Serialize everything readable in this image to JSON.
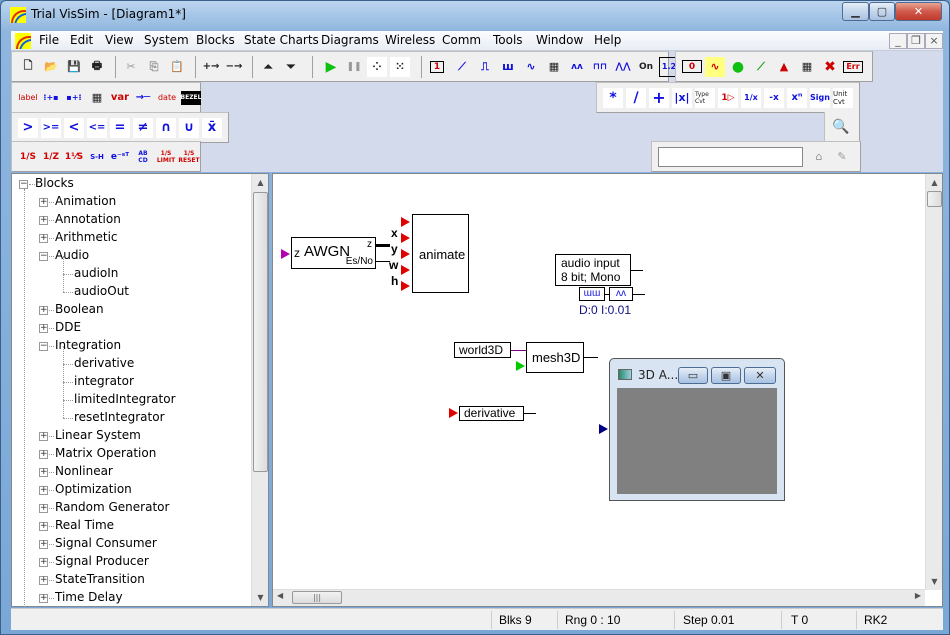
{
  "window": {
    "title": "Trial VisSim - [Diagram1*]",
    "caption_buttons": {
      "minimize": "▁",
      "maximize": "▢",
      "close": "✕"
    },
    "mdi_buttons": {
      "minimize": "_",
      "restore": "❐",
      "close": "×"
    }
  },
  "menu": [
    "File",
    "Edit",
    "View",
    "System",
    "Blocks",
    "State Charts",
    "Diagrams",
    "Wireless",
    "Comm",
    "Tools",
    "Window",
    "Help"
  ],
  "toolbars": {
    "file": [
      {
        "name": "new",
        "glyph": "🗋"
      },
      {
        "name": "open",
        "glyph": "📂"
      },
      {
        "name": "save",
        "glyph": "💾"
      },
      {
        "name": "print",
        "glyph": "🖶"
      }
    ],
    "edit": [
      {
        "name": "cut",
        "glyph": "✂"
      },
      {
        "name": "copy",
        "glyph": "⎘"
      },
      {
        "name": "paste",
        "glyph": "📋"
      }
    ],
    "connector": [
      {
        "name": "add-connector",
        "glyph": "+→"
      },
      {
        "name": "remove-connector",
        "glyph": "−→"
      }
    ],
    "hierarchy": [
      {
        "name": "go-up",
        "glyph": "⏶"
      },
      {
        "name": "go-down",
        "glyph": "⏷"
      }
    ],
    "sim": [
      {
        "name": "play",
        "glyph": "▶"
      },
      {
        "name": "pause",
        "glyph": "❚❚"
      },
      {
        "name": "step",
        "glyph": "⁘"
      },
      {
        "name": "continue",
        "glyph": "⁙"
      }
    ],
    "producers": [
      {
        "name": "const",
        "glyph": "1"
      },
      {
        "name": "ramp",
        "glyph": "⟋"
      },
      {
        "name": "step-fn",
        "glyph": "⎍"
      },
      {
        "name": "pulse-train",
        "glyph": "ш"
      },
      {
        "name": "sinusoid",
        "glyph": "∿"
      },
      {
        "name": "import",
        "glyph": "▦"
      },
      {
        "name": "sawtooth",
        "glyph": "ʌʌ"
      },
      {
        "name": "square-wave",
        "glyph": "⊓⊓"
      },
      {
        "name": "triangle-wave",
        "glyph": "⋀⋀"
      },
      {
        "name": "button",
        "glyph": "On"
      },
      {
        "name": "slider",
        "glyph": "1.2"
      }
    ],
    "consumers": [
      {
        "name": "display",
        "glyph": "0"
      },
      {
        "name": "plot",
        "glyph": "∿"
      },
      {
        "name": "light",
        "glyph": "●"
      },
      {
        "name": "xy-plot",
        "glyph": "⟋"
      },
      {
        "name": "meter",
        "glyph": "▲"
      },
      {
        "name": "export",
        "glyph": "▦"
      },
      {
        "name": "stop",
        "glyph": "✖"
      },
      {
        "name": "error",
        "glyph": "Err"
      }
    ],
    "annotation": [
      {
        "name": "label",
        "glyph": "label"
      },
      {
        "name": "variable-in",
        "glyph": "⁝+▪"
      },
      {
        "name": "variable-out",
        "glyph": "▪+⁝"
      },
      {
        "name": "comment",
        "glyph": "▦"
      },
      {
        "name": "var",
        "glyph": "var"
      },
      {
        "name": "wirepositioner",
        "glyph": "→─"
      },
      {
        "name": "date",
        "glyph": "date"
      },
      {
        "name": "bezel",
        "glyph": "BEZEL"
      }
    ],
    "relational": [
      {
        "name": "greater",
        "glyph": ">"
      },
      {
        "name": "greater-equal",
        "glyph": ">="
      },
      {
        "name": "less",
        "glyph": "<"
      },
      {
        "name": "less-equal",
        "glyph": "<="
      },
      {
        "name": "equal",
        "glyph": "="
      },
      {
        "name": "not-equal",
        "glyph": "≠"
      },
      {
        "name": "and",
        "glyph": "∩"
      },
      {
        "name": "or",
        "glyph": "∪"
      },
      {
        "name": "not",
        "glyph": "x̄"
      }
    ],
    "integration": [
      {
        "name": "integrator",
        "glyph": "1/S"
      },
      {
        "name": "unit-delay",
        "glyph": "1/Z"
      },
      {
        "name": "transfer-fn",
        "glyph": "1⅟S"
      },
      {
        "name": "sample-hold",
        "glyph": "S-H"
      },
      {
        "name": "time-delay",
        "glyph": "e⁻ˢᵀ"
      },
      {
        "name": "state-space",
        "glyph": "AB CD"
      },
      {
        "name": "limited-integrator",
        "glyph": "1/S LIMIT"
      },
      {
        "name": "reset-integrator",
        "glyph": "1/S RESET"
      }
    ],
    "arithmetic": [
      {
        "name": "multiply",
        "glyph": "*"
      },
      {
        "name": "divide",
        "glyph": "/"
      },
      {
        "name": "add",
        "glyph": "+"
      },
      {
        "name": "abs",
        "glyph": "|x|"
      },
      {
        "name": "type-convert",
        "glyph": "Type Cvt"
      },
      {
        "name": "gain",
        "glyph": "1▷"
      },
      {
        "name": "reciprocal",
        "glyph": "1/x"
      },
      {
        "name": "negate",
        "glyph": "-x"
      },
      {
        "name": "power",
        "glyph": "xⁿ"
      },
      {
        "name": "sign",
        "glyph": "Sign"
      },
      {
        "name": "unit-convert",
        "glyph": "Unit Cvt"
      }
    ],
    "zoom": {
      "glyph": "🔍"
    },
    "search": {
      "value": "",
      "placeholder": ""
    }
  },
  "tree": {
    "root": "Blocks",
    "items": [
      {
        "label": "Animation",
        "level": 1,
        "state": "collapsed"
      },
      {
        "label": "Annotation",
        "level": 1,
        "state": "collapsed"
      },
      {
        "label": "Arithmetic",
        "level": 1,
        "state": "collapsed"
      },
      {
        "label": "Audio",
        "level": 1,
        "state": "expanded"
      },
      {
        "label": "audioIn",
        "level": 2,
        "state": "leaf"
      },
      {
        "label": "audioOut",
        "level": 2,
        "state": "leaf"
      },
      {
        "label": "Boolean",
        "level": 1,
        "state": "collapsed"
      },
      {
        "label": "DDE",
        "level": 1,
        "state": "collapsed"
      },
      {
        "label": "Integration",
        "level": 1,
        "state": "expanded"
      },
      {
        "label": "derivative",
        "level": 2,
        "state": "leaf"
      },
      {
        "label": "integrator",
        "level": 2,
        "state": "leaf"
      },
      {
        "label": "limitedIntegrator",
        "level": 2,
        "state": "leaf"
      },
      {
        "label": "resetIntegrator",
        "level": 2,
        "state": "leaf"
      },
      {
        "label": "Linear System",
        "level": 1,
        "state": "collapsed"
      },
      {
        "label": "Matrix Operation",
        "level": 1,
        "state": "collapsed"
      },
      {
        "label": "Nonlinear",
        "level": 1,
        "state": "collapsed"
      },
      {
        "label": "Optimization",
        "level": 1,
        "state": "collapsed"
      },
      {
        "label": "Random Generator",
        "level": 1,
        "state": "collapsed"
      },
      {
        "label": "Real Time",
        "level": 1,
        "state": "collapsed"
      },
      {
        "label": "Signal Consumer",
        "level": 1,
        "state": "collapsed"
      },
      {
        "label": "Signal Producer",
        "level": 1,
        "state": "collapsed"
      },
      {
        "label": "StateTransition",
        "level": 1,
        "state": "collapsed"
      },
      {
        "label": "Time Delay",
        "level": 1,
        "state": "collapsed"
      }
    ]
  },
  "diagram": {
    "awgn": {
      "label": "AWGN",
      "in_port": "z",
      "out_z": "z",
      "out_esno": "Es/No"
    },
    "animate": {
      "label": "animate",
      "ports": [
        "",
        "x",
        "y",
        "w",
        "h"
      ]
    },
    "audio_input": {
      "line1": "audio input",
      "line2": "8 bit; Mono",
      "params": "D:0 I:0.01"
    },
    "world3d": {
      "label": "world3D"
    },
    "mesh3d": {
      "label": "mesh3D"
    },
    "derivative": {
      "label": "derivative"
    },
    "anim_window": {
      "title": "3D A...",
      "min": "▭",
      "max": "▣",
      "close": "✕"
    }
  },
  "statusbar": {
    "blocks": "Blks  9",
    "range": "Rng  0 : 10",
    "step": "Step  0.01",
    "time": "T  0",
    "method": "RK2"
  },
  "colors": {
    "port_red": "#e00000",
    "port_green": "#00cc00",
    "port_magenta": "#b000b0",
    "port_navy": "#000080",
    "toolbar_bg": "#d3daec",
    "anim_viewport": "#808080"
  }
}
